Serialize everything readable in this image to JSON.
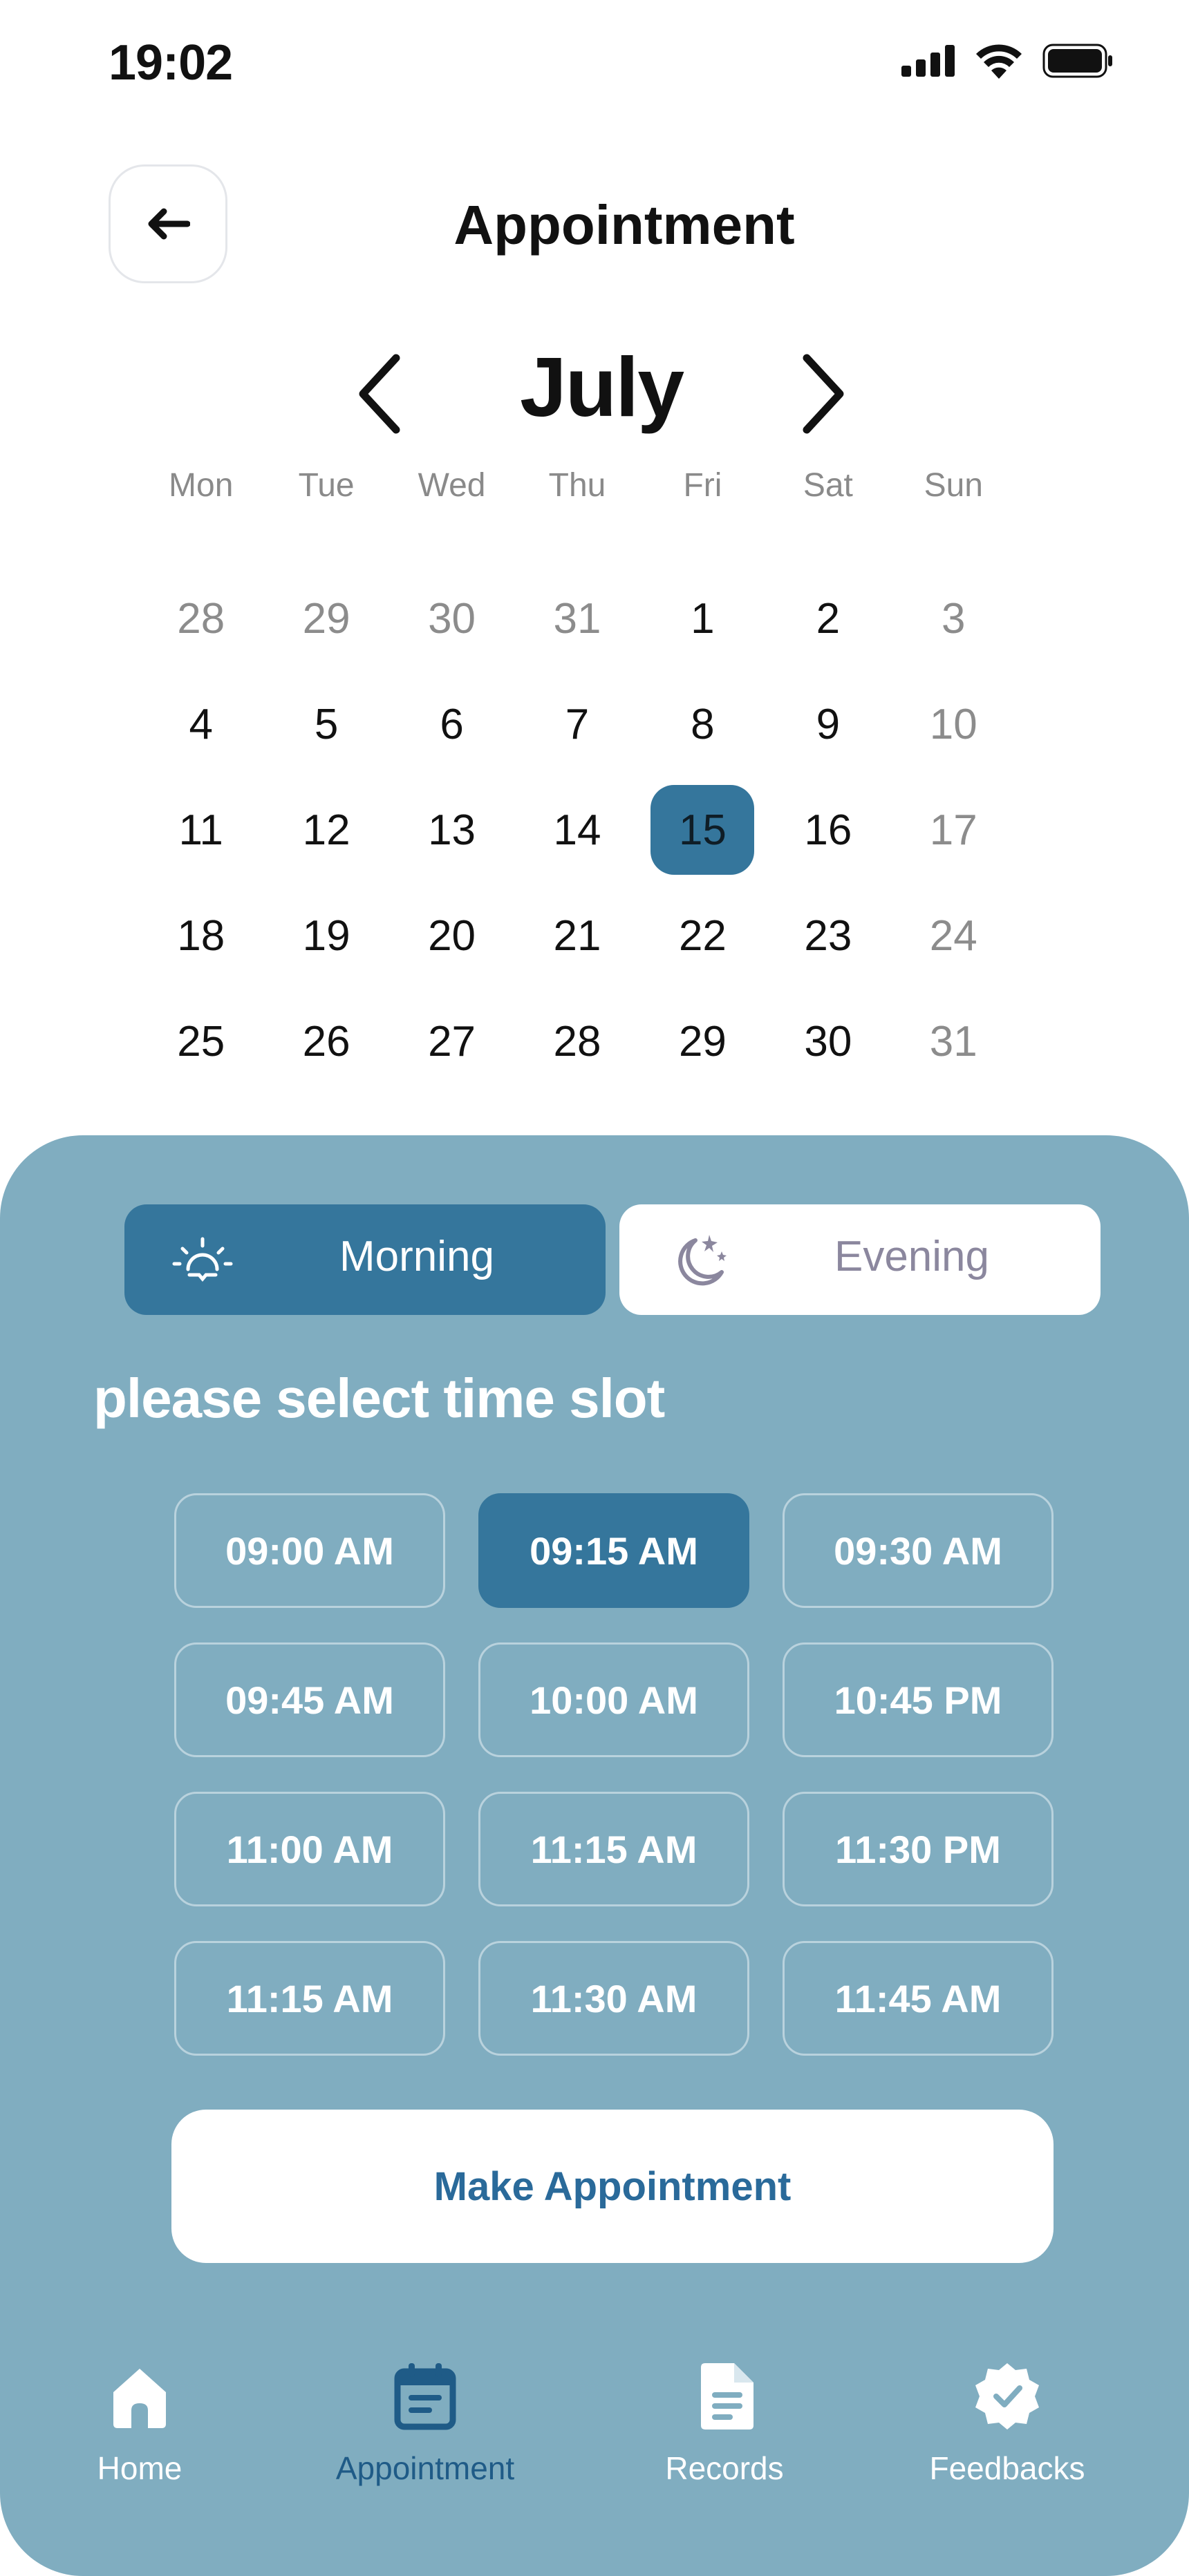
{
  "status_bar": {
    "time": "19:02"
  },
  "header": {
    "title": "Appointment"
  },
  "calendar": {
    "month": "July",
    "weekdays": [
      "Mon",
      "Tue",
      "Wed",
      "Thu",
      "Fri",
      "Sat",
      "Sun"
    ],
    "days": [
      {
        "label": "28",
        "muted": true
      },
      {
        "label": "29",
        "muted": true
      },
      {
        "label": "30",
        "muted": true
      },
      {
        "label": "31",
        "muted": true
      },
      {
        "label": "1"
      },
      {
        "label": "2"
      },
      {
        "label": "3",
        "muted": true
      },
      {
        "label": "4"
      },
      {
        "label": "5"
      },
      {
        "label": "6"
      },
      {
        "label": "7"
      },
      {
        "label": "8"
      },
      {
        "label": "9"
      },
      {
        "label": "10",
        "muted": true
      },
      {
        "label": "11"
      },
      {
        "label": "12"
      },
      {
        "label": "13"
      },
      {
        "label": "14"
      },
      {
        "label": "15",
        "selected": true
      },
      {
        "label": "16"
      },
      {
        "label": "17",
        "muted": true
      },
      {
        "label": "18"
      },
      {
        "label": "19"
      },
      {
        "label": "20"
      },
      {
        "label": "21"
      },
      {
        "label": "22"
      },
      {
        "label": "23"
      },
      {
        "label": "24",
        "muted": true
      },
      {
        "label": "25"
      },
      {
        "label": "26"
      },
      {
        "label": "27"
      },
      {
        "label": "28"
      },
      {
        "label": "29"
      },
      {
        "label": "30"
      },
      {
        "label": "31",
        "muted": true
      }
    ]
  },
  "period_toggle": {
    "morning_label": "Morning",
    "evening_label": "Evening",
    "selected": "Morning"
  },
  "slots_section": {
    "heading": "please select time slot",
    "slots": [
      "09:00 AM",
      "09:15 AM",
      "09:30 AM",
      "09:45 AM",
      "10:00 AM",
      "10:45 PM",
      "11:00 AM",
      "11:15 AM",
      "11:30 PM",
      "11:15 AM",
      "11:30 AM",
      "11:45 AM"
    ],
    "selected_index": 1
  },
  "make_appointment_label": "Make Appointment",
  "bottom_nav": {
    "items": [
      {
        "label": "Home",
        "icon": "home-icon"
      },
      {
        "label": "Appointment",
        "icon": "calendar-icon",
        "active": true
      },
      {
        "label": "Records",
        "icon": "document-icon"
      },
      {
        "label": "Feedbacks",
        "icon": "badge-check-icon"
      }
    ]
  },
  "colors": {
    "accent": "#35769c",
    "panel": "#80adc0",
    "active_nav": "#1f5b87",
    "button_text": "#2a6a9a"
  }
}
